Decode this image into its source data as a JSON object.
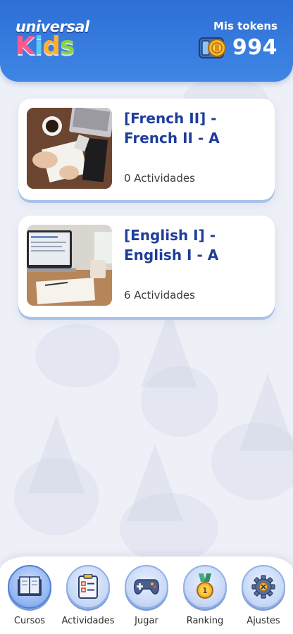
{
  "header": {
    "logo_top": "universal",
    "logo_bottom": [
      "K",
      "i",
      "d",
      "s"
    ],
    "logo_colors": [
      "#ff5a8a",
      "#5bc8f5",
      "#ffb02e",
      "#8bd24a"
    ],
    "tokens_label": "Mis tokens",
    "tokens_value": "994",
    "token_icon": "coin-ticket-icon"
  },
  "courses": [
    {
      "title": "[French II] - French II - A",
      "activities": "0 Actividades",
      "image": "desk-notebook-photo"
    },
    {
      "title": "[English I] - English I - A",
      "activities": "6 Actividades",
      "image": "laptop-desk-photo"
    }
  ],
  "nav": {
    "items": [
      {
        "label": "Cursos",
        "icon": "book-icon",
        "active": true
      },
      {
        "label": "Actividades",
        "icon": "checklist-icon",
        "active": false
      },
      {
        "label": "Jugar",
        "icon": "gamepad-icon",
        "active": false
      },
      {
        "label": "Ranking",
        "icon": "medal-icon",
        "active": false
      },
      {
        "label": "Ajustes",
        "icon": "gear-icon",
        "active": false
      }
    ]
  },
  "colors": {
    "header": "#2d6fd6",
    "title": "#1f3d9a",
    "nav_active": "#4f7fd6"
  }
}
